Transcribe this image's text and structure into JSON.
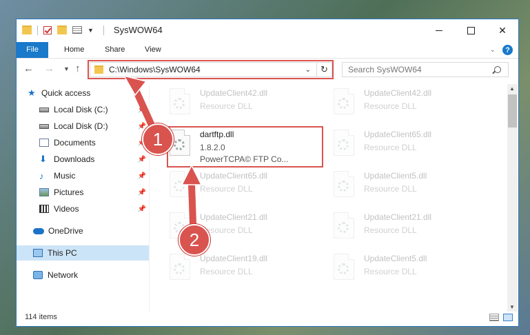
{
  "window": {
    "title": "SysWOW64",
    "controls": {
      "minimize": "",
      "maximize": "",
      "close": "✕"
    }
  },
  "ribbon": {
    "tabs": [
      "File",
      "Home",
      "Share",
      "View"
    ],
    "help": "?"
  },
  "nav": {
    "address": "C:\\Windows\\SysWOW64",
    "search_placeholder": "Search SysWOW64"
  },
  "sidebar": {
    "items": [
      {
        "label": "Quick access",
        "icon": "star-icon"
      },
      {
        "label": "Local Disk (C:)",
        "icon": "disk-icon"
      },
      {
        "label": "Local Disk (D:)",
        "icon": "disk-icon"
      },
      {
        "label": "Documents",
        "icon": "documents-icon"
      },
      {
        "label": "Downloads",
        "icon": "download-icon"
      },
      {
        "label": "Music",
        "icon": "music-icon"
      },
      {
        "label": "Pictures",
        "icon": "pictures-icon"
      },
      {
        "label": "Videos",
        "icon": "videos-icon"
      },
      {
        "label": "OneDrive",
        "icon": "cloud-icon"
      },
      {
        "label": "This PC",
        "icon": "computer-icon"
      },
      {
        "label": "Network",
        "icon": "network-icon"
      }
    ]
  },
  "files": {
    "highlighted": {
      "name": "dartftp.dll",
      "version": "1.8.2.0",
      "company": "PowerTCPA© FTP Co..."
    },
    "left": [
      {
        "name": "UpdateClient42.dll",
        "type": "Resource DLL"
      },
      {
        "name": "UpdateClient65.dll",
        "type": "Resource DLL"
      },
      {
        "name": "UpdateClient21.dll",
        "type": "Resource DLL"
      },
      {
        "name": "UpdateClient19.dll",
        "type": "Resource DLL"
      }
    ],
    "right": [
      {
        "name": "UpdateClient42.dll",
        "type": "Resource DLL"
      },
      {
        "name": "UpdateClient65.dll",
        "type": "Resource DLL"
      },
      {
        "name": "UpdateClient5.dll",
        "type": "Resource DLL"
      },
      {
        "name": "UpdateClient21.dll",
        "type": "Resource DLL"
      },
      {
        "name": "UpdateClient5.dll",
        "type": "Resource DLL"
      }
    ]
  },
  "status": {
    "item_count": "114 items"
  },
  "annotations": {
    "step1": "1",
    "step2": "2",
    "color": "#d9534f"
  }
}
